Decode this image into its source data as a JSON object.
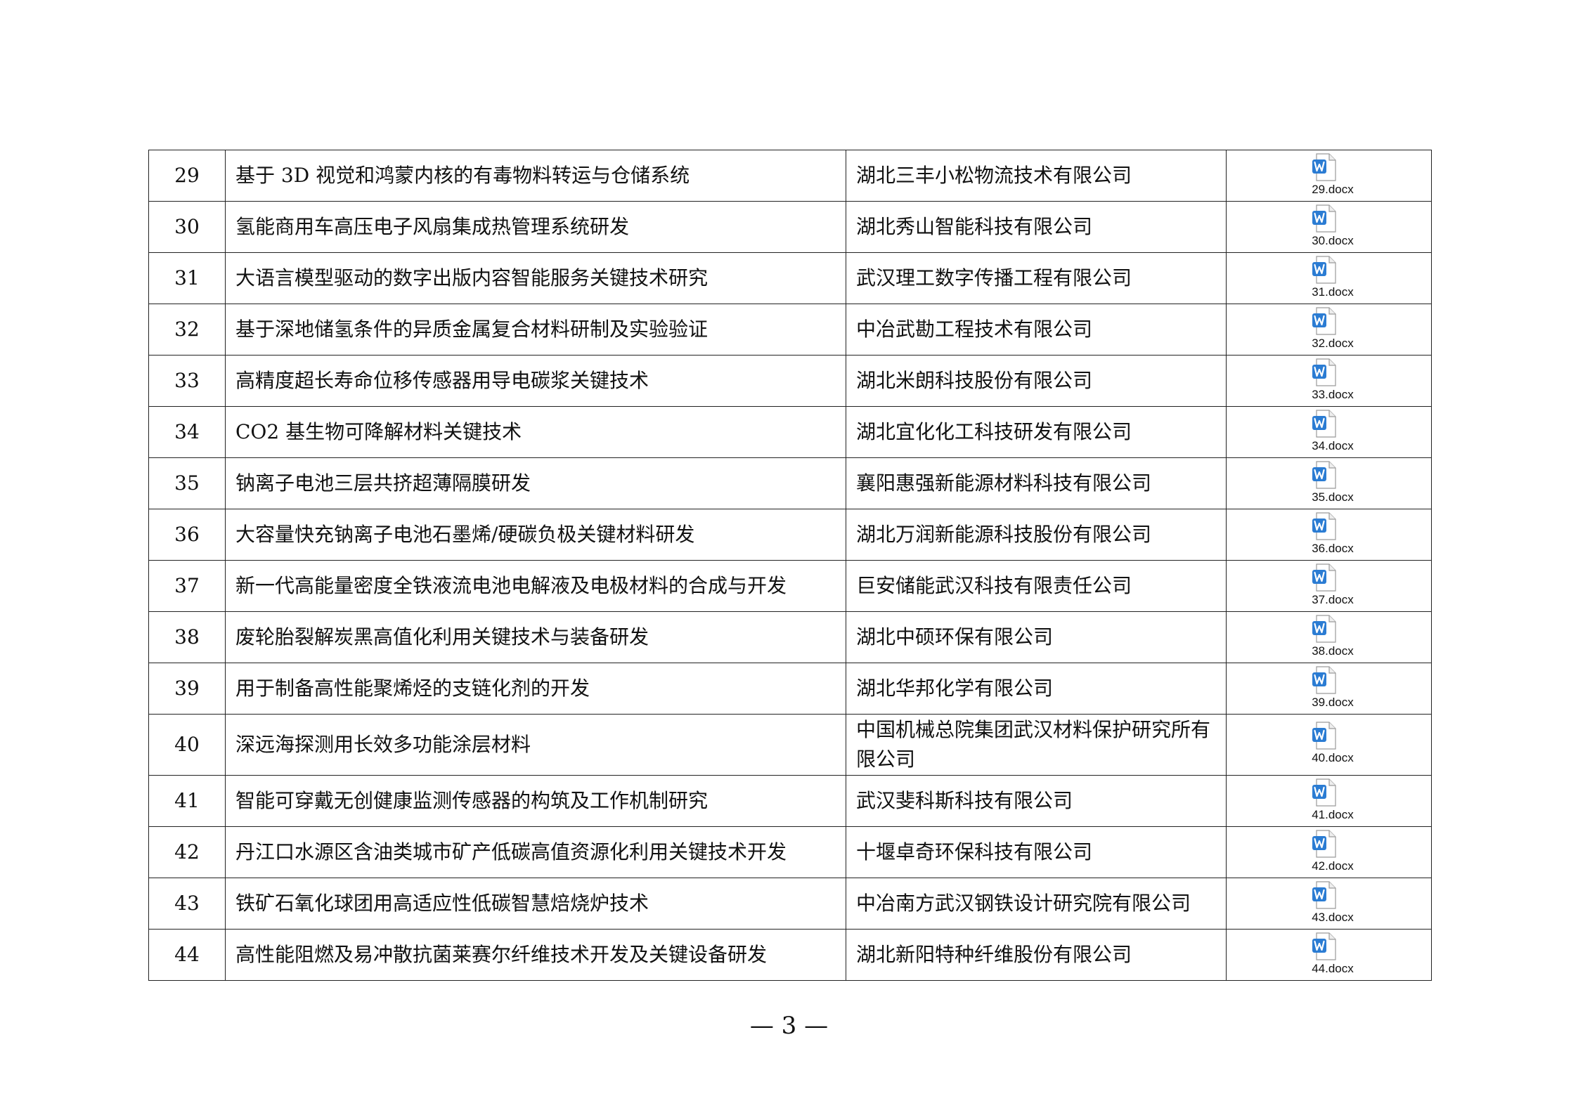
{
  "rows": [
    {
      "no": "29",
      "title": "基于 3D 视觉和鸿蒙内核的有毒物料转运与仓储系统",
      "org": "湖北三丰小松物流技术有限公司",
      "file": "29.docx"
    },
    {
      "no": "30",
      "title": "氢能商用车高压电子风扇集成热管理系统研发",
      "org": "湖北秀山智能科技有限公司",
      "file": "30.docx"
    },
    {
      "no": "31",
      "title": "大语言模型驱动的数字出版内容智能服务关键技术研究",
      "org": "武汉理工数字传播工程有限公司",
      "file": "31.docx"
    },
    {
      "no": "32",
      "title": "基于深地储氢条件的异质金属复合材料研制及实验验证",
      "org": "中冶武勘工程技术有限公司",
      "file": "32.docx"
    },
    {
      "no": "33",
      "title": "高精度超长寿命位移传感器用导电碳浆关键技术",
      "org": "湖北米朗科技股份有限公司",
      "file": "33.docx"
    },
    {
      "no": "34",
      "title": "CO2 基生物可降解材料关键技术",
      "org": "湖北宜化化工科技研发有限公司",
      "file": "34.docx"
    },
    {
      "no": "35",
      "title": "钠离子电池三层共挤超薄隔膜研发",
      "org": "襄阳惠强新能源材料科技有限公司",
      "file": "35.docx"
    },
    {
      "no": "36",
      "title": "大容量快充钠离子电池石墨烯/硬碳负极关键材料研发",
      "org": "湖北万润新能源科技股份有限公司",
      "file": "36.docx"
    },
    {
      "no": "37",
      "title": "新一代高能量密度全铁液流电池电解液及电极材料的合成与开发",
      "org": "巨安储能武汉科技有限责任公司",
      "file": "37.docx"
    },
    {
      "no": "38",
      "title": "废轮胎裂解炭黑高值化利用关键技术与装备研发",
      "org": "湖北中硕环保有限公司",
      "file": "38.docx"
    },
    {
      "no": "39",
      "title": "用于制备高性能聚烯烃的支链化剂的开发",
      "org": "湖北华邦化学有限公司",
      "file": "39.docx"
    },
    {
      "no": "40",
      "title": "深远海探测用长效多功能涂层材料",
      "org": "中国机械总院集团武汉材料保护研究所有限公司",
      "file": "40.docx"
    },
    {
      "no": "41",
      "title": "智能可穿戴无创健康监测传感器的构筑及工作机制研究",
      "org": "武汉斐科斯科技有限公司",
      "file": "41.docx"
    },
    {
      "no": "42",
      "title": "丹江口水源区含油类城市矿产低碳高值资源化利用关键技术开发",
      "org": "十堰卓奇环保科技有限公司",
      "file": "42.docx"
    },
    {
      "no": "43",
      "title": "铁矿石氧化球团用高适应性低碳智慧焙烧炉技术",
      "org": "中冶南方武汉钢铁设计研究院有限公司",
      "file": "43.docx"
    },
    {
      "no": "44",
      "title": "高性能阻燃及易冲散抗菌莱赛尔纤维技术开发及关键设备研发",
      "org": "湖北新阳特种纤维股份有限公司",
      "file": "44.docx"
    }
  ],
  "footer": {
    "page_number": "— 3 —"
  },
  "icon": {
    "name": "word-document-icon",
    "accent": "#2b7cd3"
  }
}
